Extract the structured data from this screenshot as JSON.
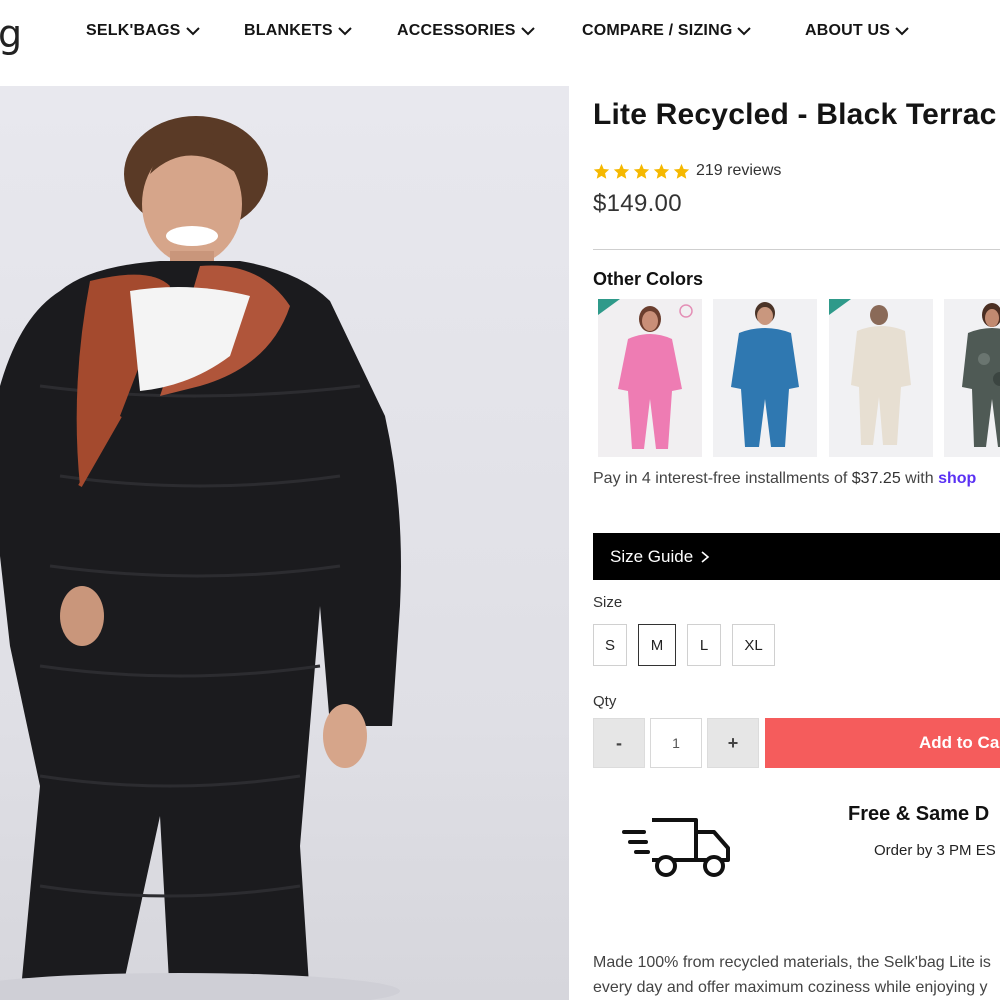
{
  "header": {
    "logo_text": "g",
    "nav": [
      {
        "label": "SELK'BAGS",
        "icon": "chevron-down-icon"
      },
      {
        "label": "BLANKETS",
        "icon": "chevron-down-icon"
      },
      {
        "label": "ACCESSORIES",
        "icon": "chevron-down-icon"
      },
      {
        "label": "COMPARE / SIZING",
        "icon": "chevron-down-icon"
      },
      {
        "label": "ABOUT US",
        "icon": "chevron-down-icon"
      }
    ]
  },
  "product": {
    "title": "Lite Recycled - Black Terrac",
    "rating": 5,
    "rating_max": 5,
    "reviews_label": "219 reviews",
    "price": "$149.00",
    "star_color": "#f5b800"
  },
  "other_colors": {
    "label": "Other Colors",
    "swatches": [
      {
        "name": "pink",
        "color": "#ef7fb6",
        "badge": "NEW"
      },
      {
        "name": "blue",
        "color": "#2f78b1",
        "badge": ""
      },
      {
        "name": "cream",
        "color": "#e7dfd2",
        "badge": "NEW"
      },
      {
        "name": "dark-camo",
        "color": "#4f5a55",
        "badge": ""
      }
    ]
  },
  "installments": {
    "prefix": "Pay in 4 interest-free installments of ",
    "amount": "$37.25",
    "middle": " with ",
    "brand": "shop"
  },
  "size_guide": {
    "label": "Size Guide"
  },
  "sizes": {
    "label": "Size",
    "options": [
      "S",
      "M",
      "L",
      "XL"
    ],
    "selected": "M"
  },
  "qty": {
    "label": "Qty",
    "minus": "-",
    "value": "1",
    "plus": "+"
  },
  "add_to_cart": {
    "label": "Add to Ca",
    "color": "#f55c5c"
  },
  "shipping": {
    "title": "Free & Same D",
    "subtitle": "Order by 3 PM ES",
    "icon": "delivery-truck-icon"
  },
  "description": {
    "line1": "Made 100% from recycled materials, the Selk'bag Lite is",
    "line2": "every day and offer maximum coziness while enjoying y"
  }
}
